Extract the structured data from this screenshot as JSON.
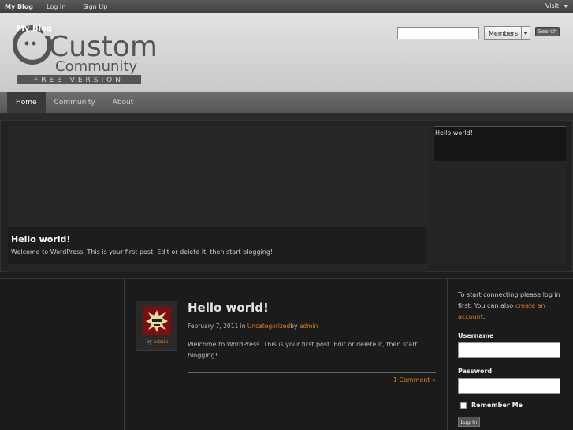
{
  "adminbar": {
    "site_name": "My Blog",
    "login": "Log In",
    "signup": "Sign Up",
    "visit": "Visit"
  },
  "header": {
    "logo_overlay": "My Blog",
    "logo_line1": "Custom",
    "logo_line2": "Community",
    "logo_badge": "FREE VERSION",
    "search_value": "",
    "members_option": "Members",
    "search_button": "Search"
  },
  "nav": {
    "items": [
      "Home",
      "Community",
      "About"
    ],
    "active": "Home"
  },
  "slider": {
    "caption_title": "Hello world!",
    "caption_excerpt": "Welcome to WordPress. This is your first post. Edit or delete it, then start blogging!",
    "list_item": "Hello world!"
  },
  "post": {
    "avatar_by": "by",
    "author": "admin",
    "title": "Hello world!",
    "date": "February 7, 2011",
    "in": "in",
    "category": "Uncategorized",
    "by": "by",
    "body": "Welcome to WordPress. This is your first post. Edit or delete it, then start blogging!",
    "comments": "1 Comment »"
  },
  "sidebar": {
    "intro_prefix": "To start connecting please log in first. You can also ",
    "intro_link": "create an account",
    "intro_suffix": ".",
    "username_label": "Username",
    "password_label": "Password",
    "remember_label": "Remember Me",
    "login_button": "Log In"
  },
  "colors": {
    "accent": "#e07a1f",
    "header_bg": "#d5d5d5",
    "page_bg": "#1e1e1e"
  }
}
